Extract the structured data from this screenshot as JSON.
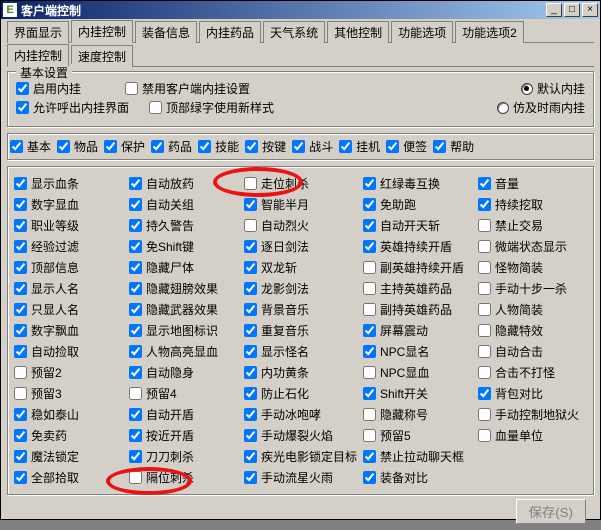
{
  "window": {
    "title": "客户端控制"
  },
  "winbuttons": {
    "min": "_",
    "max": "□",
    "close": "×"
  },
  "icon_letter": "E",
  "tabs_main": [
    "界面显示",
    "内挂控制",
    "装备信息",
    "内挂药品",
    "天气系统",
    "其他控制",
    "功能选项",
    "功能选项2"
  ],
  "tabs_main_active": 1,
  "tabs_sub": [
    "内挂控制",
    "速度控制"
  ],
  "tabs_sub_active": 0,
  "group_basic": {
    "title": "基本设置",
    "row1": [
      {
        "label": "启用内挂",
        "checked": true
      },
      {
        "label": "禁用客户端内挂设置",
        "checked": false
      }
    ],
    "row1_radios": [
      {
        "label": "默认内挂",
        "selected": true
      },
      {
        "label": "仿及时雨内挂",
        "selected": false
      }
    ],
    "row2": [
      {
        "label": "允许呼出内挂界面",
        "checked": true
      },
      {
        "label": "顶部绿字使用新样式",
        "checked": false
      }
    ]
  },
  "filters": [
    {
      "label": "基本",
      "checked": true
    },
    {
      "label": "物品",
      "checked": true
    },
    {
      "label": "保护",
      "checked": true
    },
    {
      "label": "药品",
      "checked": true
    },
    {
      "label": "技能",
      "checked": true
    },
    {
      "label": "按键",
      "checked": true
    },
    {
      "label": "战斗",
      "checked": true
    },
    {
      "label": "挂机",
      "checked": true
    },
    {
      "label": "便签",
      "checked": true
    },
    {
      "label": "帮助",
      "checked": true
    }
  ],
  "grid": [
    [
      {
        "l": "显示血条",
        "c": true
      },
      {
        "l": "自动放药",
        "c": true
      },
      {
        "l": "走位刺杀",
        "c": false
      },
      {
        "l": "红绿毒互换",
        "c": true
      },
      {
        "l": "音量",
        "c": true
      }
    ],
    [
      {
        "l": "数字显血",
        "c": true
      },
      {
        "l": "自动关组",
        "c": true
      },
      {
        "l": "智能半月",
        "c": true
      },
      {
        "l": "免助跑",
        "c": true
      },
      {
        "l": "持续挖取",
        "c": true
      }
    ],
    [
      {
        "l": "职业等级",
        "c": true
      },
      {
        "l": "持久警告",
        "c": true
      },
      {
        "l": "自动烈火",
        "c": false
      },
      {
        "l": "自动开天斩",
        "c": true
      },
      {
        "l": "禁止交易",
        "c": false
      }
    ],
    [
      {
        "l": "经验过滤",
        "c": true
      },
      {
        "l": "免Shift键",
        "c": true
      },
      {
        "l": "逐日剑法",
        "c": true
      },
      {
        "l": "英雄持续开盾",
        "c": true
      },
      {
        "l": "微端状态显示",
        "c": false
      }
    ],
    [
      {
        "l": "顶部信息",
        "c": true
      },
      {
        "l": "隐藏尸体",
        "c": true
      },
      {
        "l": "双龙斩",
        "c": true
      },
      {
        "l": "副英雄持续开盾",
        "c": false
      },
      {
        "l": "怪物简装",
        "c": false
      }
    ],
    [
      {
        "l": "显示人名",
        "c": true
      },
      {
        "l": "隐藏翅膀效果",
        "c": true
      },
      {
        "l": "龙影剑法",
        "c": true
      },
      {
        "l": "主持英雄药品",
        "c": false
      },
      {
        "l": "手动十步一杀",
        "c": false
      }
    ],
    [
      {
        "l": "只显人名",
        "c": true
      },
      {
        "l": "隐藏武器效果",
        "c": true
      },
      {
        "l": "背景音乐",
        "c": true
      },
      {
        "l": "副持英雄药品",
        "c": false
      },
      {
        "l": "人物简装",
        "c": false
      }
    ],
    [
      {
        "l": "数字飘血",
        "c": true
      },
      {
        "l": "显示地图标识",
        "c": true
      },
      {
        "l": "重复音乐",
        "c": true
      },
      {
        "l": "屏幕震动",
        "c": true
      },
      {
        "l": "隐藏特效",
        "c": false
      }
    ],
    [
      {
        "l": "自动捡取",
        "c": true
      },
      {
        "l": "人物高亮显血",
        "c": true
      },
      {
        "l": "显示怪名",
        "c": true
      },
      {
        "l": "NPC显名",
        "c": true
      },
      {
        "l": "自动合击",
        "c": false
      }
    ],
    [
      {
        "l": "预留2",
        "c": false
      },
      {
        "l": "自动隐身",
        "c": true
      },
      {
        "l": "内功黄条",
        "c": true
      },
      {
        "l": "NPC显血",
        "c": false
      },
      {
        "l": "合击不打怪",
        "c": false
      }
    ],
    [
      {
        "l": "预留3",
        "c": false
      },
      {
        "l": "预留4",
        "c": false
      },
      {
        "l": "防止石化",
        "c": true
      },
      {
        "l": "Shift开关",
        "c": true
      },
      {
        "l": "背包对比",
        "c": true
      }
    ],
    [
      {
        "l": "稳如泰山",
        "c": true
      },
      {
        "l": "自动开盾",
        "c": true
      },
      {
        "l": "手动冰咆哮",
        "c": true
      },
      {
        "l": "隐藏称号",
        "c": false
      },
      {
        "l": "手动控制地狱火",
        "c": false
      }
    ],
    [
      {
        "l": "免卖药",
        "c": true
      },
      {
        "l": "按近开盾",
        "c": true
      },
      {
        "l": "手动爆裂火焰",
        "c": true
      },
      {
        "l": "预留5",
        "c": false
      },
      {
        "l": "血量单位",
        "c": false
      }
    ],
    [
      {
        "l": "魔法锁定",
        "c": true
      },
      {
        "l": "刀刀刺杀",
        "c": true
      },
      {
        "l": "疾光电影锁定目标",
        "c": true
      },
      {
        "l": "禁止拉动聊天框",
        "c": true
      },
      {
        "l": "",
        "c": null
      }
    ],
    [
      {
        "l": "全部拾取",
        "c": true
      },
      {
        "l": "隔位刺杀",
        "c": false
      },
      {
        "l": "手动流星火雨",
        "c": true
      },
      {
        "l": "装备对比",
        "c": true
      },
      {
        "l": "",
        "c": null
      }
    ]
  ],
  "save_label": "保存(S)"
}
